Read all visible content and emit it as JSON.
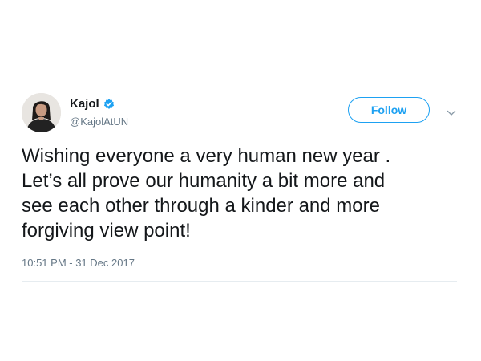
{
  "user": {
    "display_name": "Kajol",
    "handle": "@KajolAtUN",
    "verified": true
  },
  "follow_button": {
    "label": "Follow"
  },
  "tweet": {
    "text_lines": [
      "Wishing everyone a very human new year .",
      "Let’s all prove our humanity a bit more and",
      "see each other through a kinder and more",
      "forgiving view point!"
    ],
    "timestamp": "10:51 PM - 31 Dec 2017"
  },
  "colors": {
    "accent": "#1da1f2",
    "text": "#14171a",
    "secondary_text": "#657786",
    "divider": "#e6ecf0"
  },
  "icons": {
    "verified": "verified-badge-icon",
    "more": "chevron-down-icon"
  }
}
